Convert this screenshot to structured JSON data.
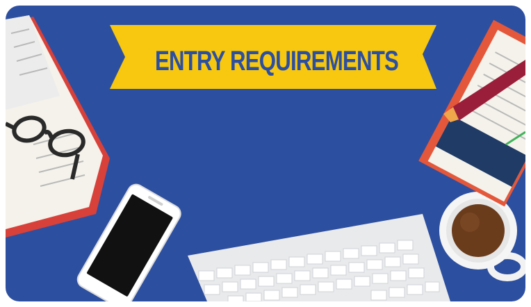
{
  "banner": {
    "title": "ENTRY REQUIREMENTS"
  },
  "colors": {
    "background": "#2d4fa0",
    "banner": "#f7c80f",
    "banner_text": "#2d4fa0",
    "book_cover": "#d8413a",
    "coffee": "#6b3c1c"
  },
  "icons": [
    "book-icon",
    "glasses-icon",
    "smartphone-icon",
    "keyboard-icon",
    "coffee-cup-icon",
    "notebook-icon",
    "pen-icon"
  ]
}
